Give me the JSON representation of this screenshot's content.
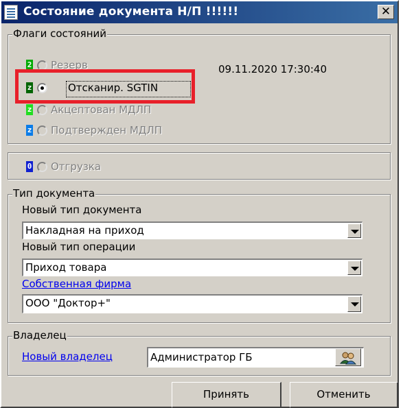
{
  "window": {
    "title": "Состояние документа Н/П !!!!!!",
    "close_glyph": "✕"
  },
  "flags": {
    "legend": "Флаги состояний",
    "reserve": {
      "badge": "2",
      "label": "Резерв",
      "badge_color": "#00aa00"
    },
    "timestamp": "09.11.2020 17:30:40",
    "scanned": {
      "badge": "z",
      "label": "Отсканир. SGTIN",
      "badge_color": "#006400",
      "selected": true
    },
    "accepted": {
      "badge": "z",
      "label": "Акцептован МДЛП",
      "badge_color": "#22dd22"
    },
    "confirmed": {
      "badge": "z",
      "label": "Подтвержден МДЛП",
      "badge_color": "#0a7ce8"
    },
    "shipment": {
      "badge": "0",
      "label": "Отгрузка",
      "badge_color": "#1020d0"
    }
  },
  "doc_type": {
    "legend": "Тип документа",
    "new_doc_type_label": "Новый тип документа",
    "new_doc_type_value": "Накладная на приход",
    "new_op_type_label": "Новый тип операции",
    "new_op_type_value": "Приход товара",
    "own_firm_link": "Собственная фирма",
    "own_firm_value": "ООО \"Доктор+\""
  },
  "owner": {
    "legend": "Владелец",
    "new_owner_link": "Новый владелец",
    "owner_value": "Администратор ГБ"
  },
  "buttons": {
    "accept": "Принять",
    "cancel": "Отменить"
  },
  "colors": {
    "highlight": "#e8202a",
    "title_bar": "#0a246a"
  }
}
